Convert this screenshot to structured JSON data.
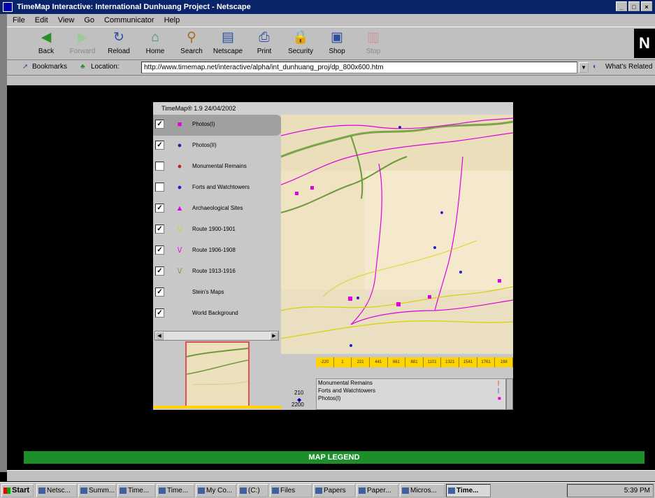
{
  "window": {
    "title": "TimeMap Interactive: International Dunhuang Project - Netscape"
  },
  "menu": [
    "File",
    "Edit",
    "View",
    "Go",
    "Communicator",
    "Help"
  ],
  "toolbar": [
    {
      "label": "Back",
      "icon": "back-arrow-icon",
      "enabled": true
    },
    {
      "label": "Forward",
      "icon": "forward-arrow-icon",
      "enabled": false
    },
    {
      "label": "Reload",
      "icon": "reload-icon",
      "enabled": true
    },
    {
      "label": "Home",
      "icon": "home-icon",
      "enabled": true
    },
    {
      "label": "Search",
      "icon": "search-icon",
      "enabled": true
    },
    {
      "label": "Netscape",
      "icon": "netscape-icon",
      "enabled": true
    },
    {
      "label": "Print",
      "icon": "print-icon",
      "enabled": true
    },
    {
      "label": "Security",
      "icon": "lock-icon",
      "enabled": true
    },
    {
      "label": "Shop",
      "icon": "shop-icon",
      "enabled": true
    },
    {
      "label": "Stop",
      "icon": "stop-icon",
      "enabled": false
    }
  ],
  "location": {
    "bookmarks_label": "Bookmarks",
    "location_label": "Location:",
    "url": "http://www.timemap.net/interactive/alpha/int_dunhuang_proj/dp_800x600.htm",
    "related_label": "What's Related"
  },
  "applet": {
    "title": "TimeMap® 1.9 24/04/2002",
    "layers": [
      {
        "label": "Photos(I)",
        "checked": true,
        "symbol": "■",
        "color": "#e000e0",
        "selected": true
      },
      {
        "label": "Photos(II)",
        "checked": true,
        "symbol": "●",
        "color": "#2020c0",
        "selected": false
      },
      {
        "label": "Monumental Remains",
        "checked": false,
        "symbol": "●",
        "color": "#c02020",
        "selected": false
      },
      {
        "label": "Forts and Watchtowers",
        "checked": false,
        "symbol": "●",
        "color": "#2020c0",
        "selected": false
      },
      {
        "label": "Archaeological Sites",
        "checked": true,
        "symbol": "▲",
        "color": "#e000e0",
        "selected": false
      },
      {
        "label": "Route 1900-1901",
        "checked": true,
        "symbol": "\\/",
        "color": "#d8d000",
        "selected": false
      },
      {
        "label": "Route 1906-1908",
        "checked": true,
        "symbol": "\\/",
        "color": "#e000e0",
        "selected": false
      },
      {
        "label": "Route 1913-1916",
        "checked": true,
        "symbol": "\\/",
        "color": "#60a030",
        "selected": false
      },
      {
        "label": "Stein's Maps",
        "checked": true,
        "symbol": "",
        "color": "#000000",
        "selected": false
      },
      {
        "label": "World Background",
        "checked": true,
        "symbol": "",
        "color": "#000000",
        "selected": false
      }
    ],
    "timeline_ticks": [
      "-220",
      "1",
      "221",
      "441",
      "661",
      "881",
      "1101",
      "1321",
      "1541",
      "1761",
      "198"
    ],
    "time_value_1": "210",
    "time_value_2": "2200",
    "legend_items": [
      {
        "label": "Monumental Remains",
        "marker": "|",
        "color": "#c02020"
      },
      {
        "label": "Forts and Watchtowers",
        "marker": "|",
        "color": "#2020c0"
      },
      {
        "label": "Photos(I)",
        "marker": "■",
        "color": "#e000e0"
      }
    ]
  },
  "map_legend_button": "MAP LEGEND",
  "taskbar": {
    "start": "Start",
    "tasks": [
      "Netsc...",
      "Summ...",
      "Time...",
      "Time...",
      "My Co...",
      "(C:)",
      "Files",
      "Papers",
      "Paper...",
      "Micros...",
      "Time..."
    ],
    "active_task_index": 10,
    "clock": "5:39 PM"
  },
  "colors": {
    "title_bar": "#0a246a",
    "map_legend": "#1a8f2a",
    "timeline": "#ffd400"
  }
}
